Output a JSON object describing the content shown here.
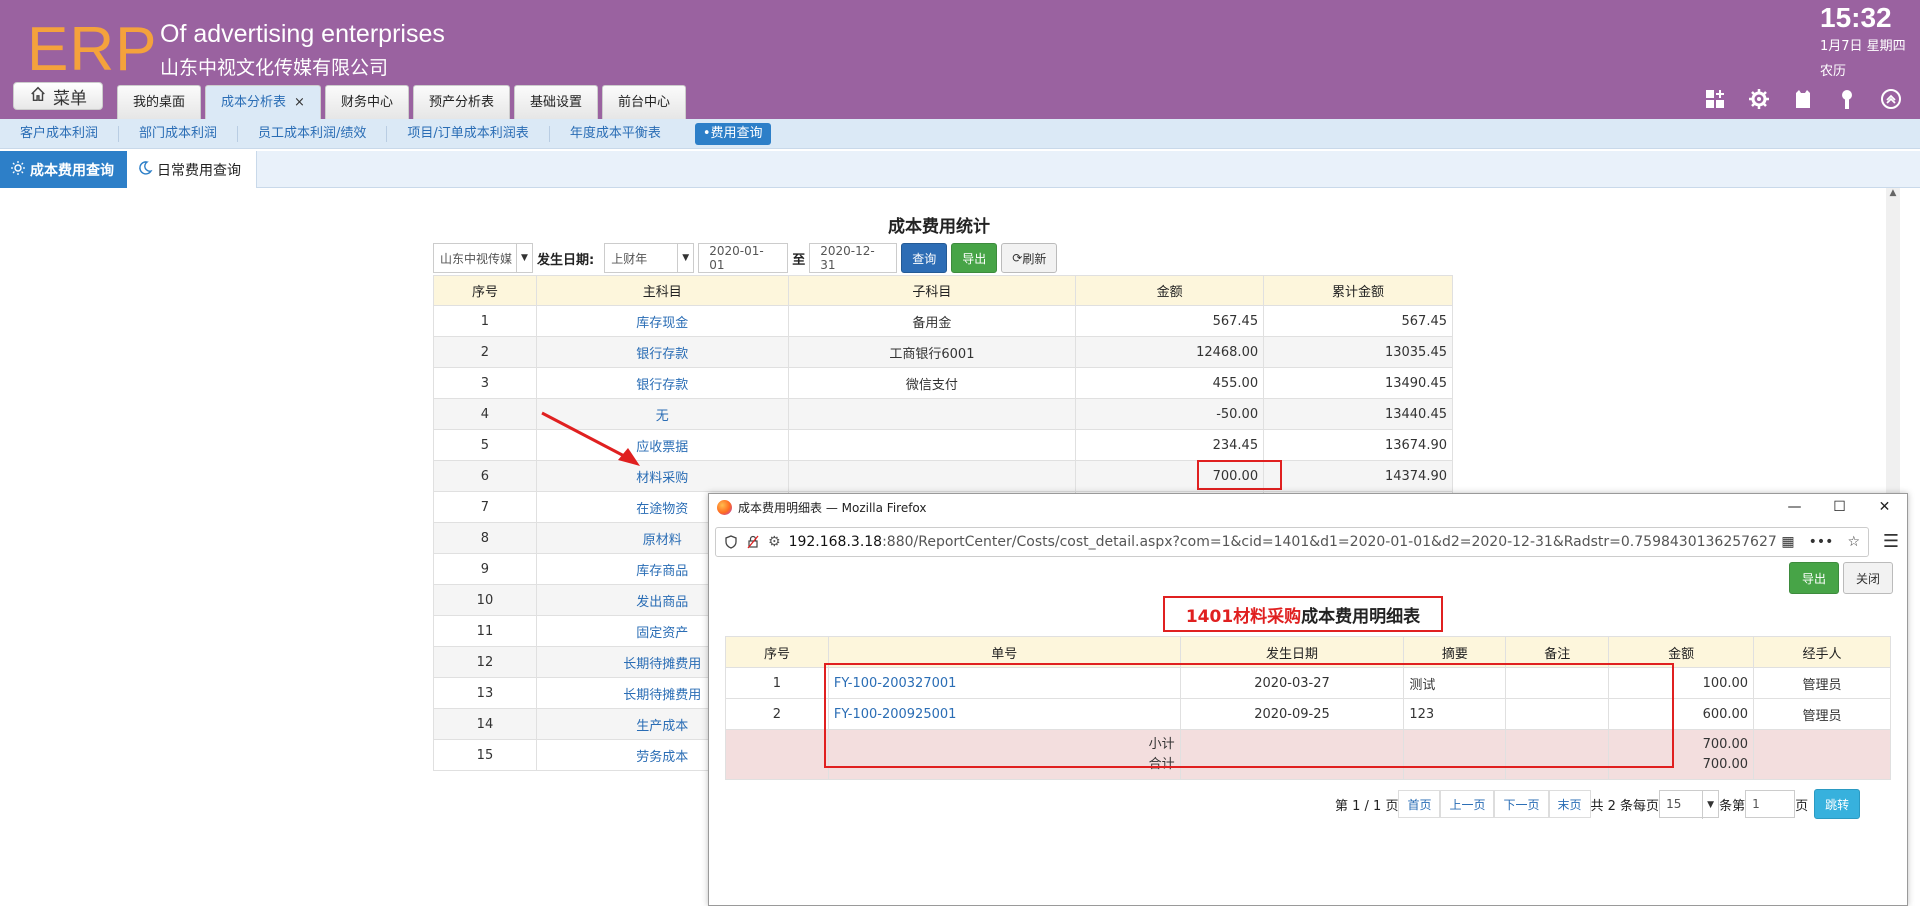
{
  "header": {
    "logo": "ERP",
    "company_en": "Of advertising enterprises",
    "company_cn": "山东中视文化传媒有限公司",
    "time": "15:32",
    "date": "1月7日 星期四",
    "lunar": "农历",
    "menu_label": "菜单",
    "tabs": [
      {
        "label": "我的桌面"
      },
      {
        "label": "成本分析表",
        "close": "×"
      },
      {
        "label": "财务中心"
      },
      {
        "label": "预产分析表"
      },
      {
        "label": "基础设置"
      },
      {
        "label": "前台中心"
      }
    ]
  },
  "subnav": [
    "客户成本利润",
    "部门成本利润",
    "员工成本利润/绩效",
    "项目/订单成本利润表",
    "年度成本平衡表",
    "•费用查询"
  ],
  "pagetabs": {
    "active": "成本费用查询",
    "other": "日常费用查询"
  },
  "report": {
    "title": "成本费用统计",
    "company_select": "山东中视传媒",
    "date_label": "发生日期:",
    "period_select": "上财年",
    "date_from": "2020-01-01",
    "to_label": "至",
    "date_to": "2020-12-31",
    "query_btn": "查询",
    "export_btn": "导出",
    "refresh_btn": "刷新",
    "columns": [
      "序号",
      "主科目",
      "子科目",
      "金额",
      "累计金额"
    ],
    "rows": [
      {
        "no": "1",
        "main": "库存现金",
        "sub": "备用金",
        "amount": "567.45",
        "total": "567.45"
      },
      {
        "no": "2",
        "main": "银行存款",
        "sub": "工商银行6001",
        "amount": "12468.00",
        "total": "13035.45"
      },
      {
        "no": "3",
        "main": "银行存款",
        "sub": "微信支付",
        "amount": "455.00",
        "total": "13490.45"
      },
      {
        "no": "4",
        "main": "无",
        "sub": "",
        "amount": "-50.00",
        "total": "13440.45"
      },
      {
        "no": "5",
        "main": "应收票据",
        "sub": "",
        "amount": "234.45",
        "total": "13674.90"
      },
      {
        "no": "6",
        "main": "材料采购",
        "sub": "",
        "amount": "700.00",
        "total": "14374.90"
      },
      {
        "no": "7",
        "main": "在途物资",
        "sub": "",
        "amount": "",
        "total": ""
      },
      {
        "no": "8",
        "main": "原材料",
        "sub": "",
        "amount": "",
        "total": ""
      },
      {
        "no": "9",
        "main": "库存商品",
        "sub": "",
        "amount": "",
        "total": ""
      },
      {
        "no": "10",
        "main": "发出商品",
        "sub": "",
        "amount": "",
        "total": ""
      },
      {
        "no": "11",
        "main": "固定资产",
        "sub": "",
        "amount": "",
        "total": ""
      },
      {
        "no": "12",
        "main": "长期待摊费用",
        "sub": "",
        "amount": "",
        "total": ""
      },
      {
        "no": "13",
        "main": "长期待摊费用",
        "sub": "",
        "amount": "",
        "total": ""
      },
      {
        "no": "14",
        "main": "生产成本",
        "sub": "",
        "amount": "",
        "total": ""
      },
      {
        "no": "15",
        "main": "劳务成本",
        "sub": "",
        "amount": "",
        "total": ""
      }
    ]
  },
  "popup": {
    "window_title": "成本费用明细表 — Mozilla Firefox",
    "url_host": "192.168.3.18",
    "url_rest": ":880/ReportCenter/Costs/cost_detail.aspx?com=1&cid=1401&d1=2020-01-01&d2=2020-12-31&Radstr=0.7598430136257627",
    "export_btn": "导出",
    "close_btn": "关闭",
    "title_red": "1401材料采购",
    "title_rest": "成本费用明细表",
    "columns": [
      "序号",
      "单号",
      "发生日期",
      "摘要",
      "备注",
      "金额",
      "经手人"
    ],
    "rows": [
      {
        "no": "1",
        "doc": "FY-100-200327001",
        "date": "2020-03-27",
        "summary": "测试",
        "note": "",
        "amount": "100.00",
        "handler": "管理员"
      },
      {
        "no": "2",
        "doc": "FY-100-200925001",
        "date": "2020-09-25",
        "summary": "123",
        "note": "",
        "amount": "600.00",
        "handler": "管理员"
      }
    ],
    "subtotal_label": "小计",
    "total_label": "合计",
    "subtotal": "700.00",
    "total": "700.00",
    "pager": {
      "page_info": "第 1 / 1 页",
      "first": "首页",
      "prev": "上一页",
      "next": "下一页",
      "last": "末页",
      "count_text": "共 2 条每页",
      "page_size": "15",
      "jump_label": "条第",
      "page_input": "1",
      "page_unit": "页",
      "jump_btn": "跳转"
    }
  },
  "colors": {
    "header_bg": "#9a62a0",
    "logo": "#f4a23c",
    "accent_blue": "#2d7fc8",
    "annotation_red": "#e02020"
  }
}
